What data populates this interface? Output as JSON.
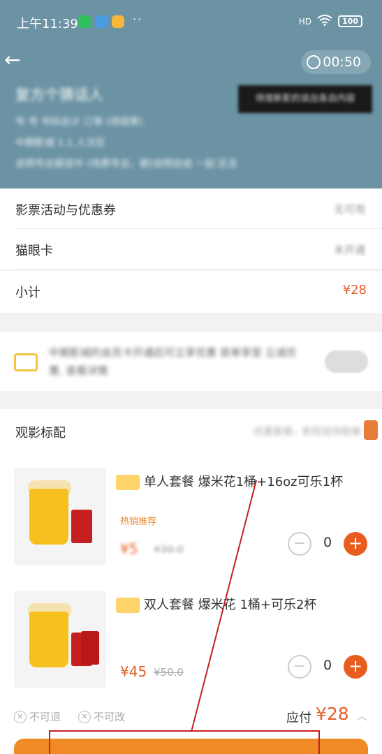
{
  "status_bar": {
    "time": "上午11:39",
    "more": "··",
    "network": "HD",
    "battery": "100"
  },
  "header": {
    "timer": "00:50",
    "title": "复方个猜话人",
    "tag": "场馆新影的说出各自内容",
    "lines": [
      "号 号 号码总计 订单 (场馆票)",
      "中期影城 1.1.人次区",
      "说明号总额说中 (场票号总，额)说明总结 一起 区总"
    ]
  },
  "rows": [
    {
      "label": "影票活动与优惠券",
      "value": "无可用"
    },
    {
      "label": "猫眼卡",
      "value": "未开通"
    }
  ],
  "subtotal": {
    "label": "小计",
    "value": "¥28"
  },
  "promo_card": {
    "text": "中期影城的会员卡开通后可立享优惠 首单享受 立减优惠, 查看详情"
  },
  "snacks": {
    "title": "观影标配",
    "more": "优惠套餐，影院现场取餐",
    "items": [
      {
        "name": "单人套餐 爆米花1桶+16oz可乐1杯",
        "promo": "热销推荐",
        "price": "¥5",
        "original": "¥30.0",
        "qty": "0"
      },
      {
        "name": "双人套餐 爆米花 1桶+可乐2杯",
        "promo": "",
        "price": "¥45",
        "original": "¥50.0",
        "qty": "0"
      }
    ]
  },
  "footer": {
    "no_refund": "不可退",
    "no_change": "不可改",
    "pay_label": "应付",
    "pay_amount": "¥28"
  },
  "colors": {
    "header_bg": "#6b93a4",
    "accent": "#e5612a",
    "plus_button": "#e85d1e",
    "annotation": "#c62020"
  }
}
